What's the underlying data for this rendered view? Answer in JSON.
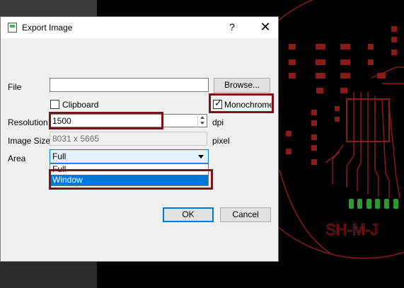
{
  "dialog": {
    "title": "Export Image",
    "help_label": "?",
    "close_label": "✕",
    "file": {
      "label": "File",
      "value": "",
      "browse_label": "Browse..."
    },
    "clipboard": {
      "label": "Clipboard",
      "checked": false
    },
    "monochrome": {
      "label": "Monochrome",
      "checked": true,
      "check_glyph": "✓"
    },
    "resolution": {
      "label": "Resolution",
      "value": "1500",
      "unit": "dpi"
    },
    "image_size": {
      "label": "Image Size",
      "value": "8031 x 5665",
      "unit": "pixel"
    },
    "area": {
      "label": "Area",
      "selected": "Full",
      "options": [
        "Full",
        "Window"
      ],
      "highlighted": "Window"
    },
    "ok_label": "OK",
    "cancel_label": "Cancel"
  },
  "board": {
    "silkscreen_text": "SH-M-J",
    "colors": {
      "trace": "#8b1a1a",
      "pad_red": "#8b1a1a",
      "pad_green": "#2e9b2e",
      "outline": "#8b1a1a"
    }
  },
  "colors": {
    "highlight_box": "#7a1515",
    "accent": "#0078d7"
  }
}
